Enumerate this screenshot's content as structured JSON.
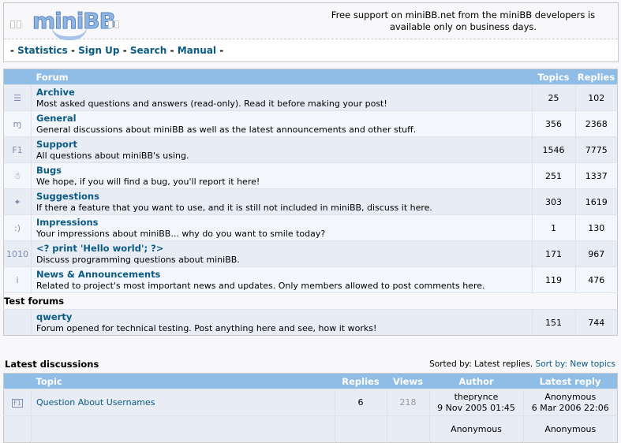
{
  "header": {
    "logo_text": "miniBB",
    "support_note": "Free support on miniBB.net from the miniBB developers is available only on business days.",
    "nav": [
      {
        "label": "Statistics"
      },
      {
        "label": "Sign Up"
      },
      {
        "label": "Search"
      },
      {
        "label": "Manual"
      }
    ],
    "nav_separator": "-"
  },
  "forums_table": {
    "columns": {
      "forum": "Forum",
      "topics": "Topics",
      "replies": "Replies"
    },
    "forums": [
      {
        "icon": "archive-icon",
        "glyph": "☰",
        "title": "Archive",
        "desc": "Most asked questions and answers (read-only). Read it before making your post!",
        "topics": "25",
        "replies": "102"
      },
      {
        "icon": "general-icon",
        "glyph": "ɱ",
        "title": "General",
        "desc": "General discussions about miniBB as well as the latest announcements and other stuff.",
        "topics": "356",
        "replies": "2368"
      },
      {
        "icon": "support-f1-icon",
        "glyph": "F1",
        "title": "Support",
        "desc": "All questions about miniBB's using.",
        "topics": "1546",
        "replies": "7775"
      },
      {
        "icon": "bug-icon",
        "glyph": "☃",
        "title": "Bugs",
        "desc": "We hope, if you will find a bug, you'll report it here!",
        "topics": "251",
        "replies": "1337"
      },
      {
        "icon": "lightbulb-icon",
        "glyph": "✦",
        "title": "Suggestions",
        "desc": "If there a feature that you want to use, and it is still not included in miniBB, discuss it here.",
        "topics": "303",
        "replies": "1619"
      },
      {
        "icon": "smiley-icon",
        "glyph": ":)",
        "title": "Impressions",
        "desc": "Your impressions about miniBB... why do you want to smile today?",
        "topics": "1",
        "replies": "130"
      },
      {
        "icon": "binary-code-icon",
        "glyph": "1010",
        "title": "<? print 'Hello world'; ?>",
        "desc": "Discuss programming questions about miniBB.",
        "topics": "171",
        "replies": "967"
      },
      {
        "icon": "info-icon",
        "glyph": "i",
        "title": "News & Announcements",
        "desc": "Related to project's most important news and updates. Only members allowed to post comments here.",
        "topics": "119",
        "replies": "476"
      }
    ],
    "category": "Test forums",
    "test_forums": [
      {
        "title": "qwerty",
        "desc": "Forum opened for technical testing. Post anything here and see, how it works!",
        "topics": "151",
        "replies": "744"
      }
    ]
  },
  "latest": {
    "title": "Latest discussions",
    "sorted_by": "Sorted by: Latest replies.",
    "sort_link": "Sort by: New topics",
    "columns": {
      "topic": "Topic",
      "replies": "Replies",
      "views": "Views",
      "author": "Author",
      "latest_reply": "Latest reply"
    },
    "rows": [
      {
        "topic": "Question About Usernames",
        "replies": "6",
        "views": "218",
        "author": "theprynce",
        "author_date": "9 Nov 2005 01:45",
        "last_user": "Anonymous",
        "last_date": "6 Mar 2006 22:06"
      },
      {
        "topic": "",
        "replies": "",
        "views": "",
        "author": "Anonymous",
        "author_date": "",
        "last_user": "Anonymous",
        "last_date": ""
      }
    ]
  }
}
